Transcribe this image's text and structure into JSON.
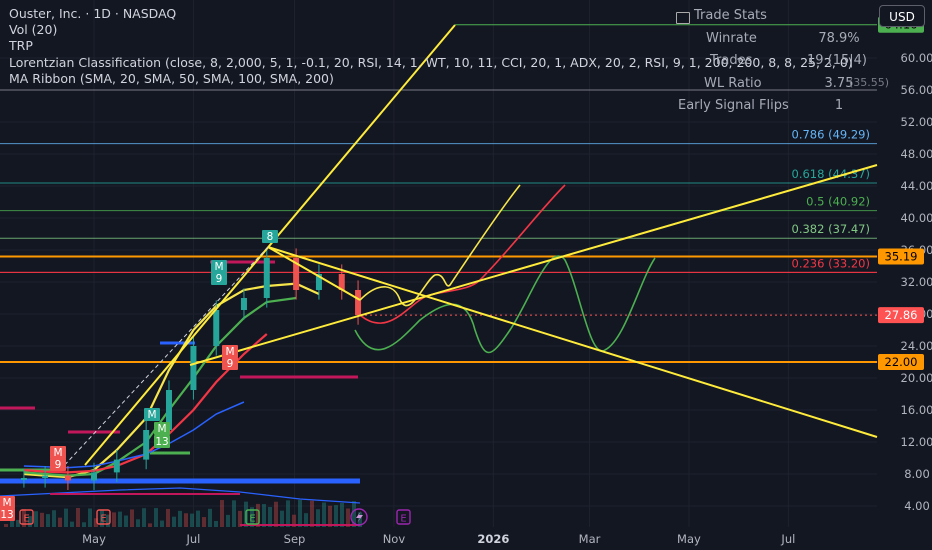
{
  "header": {
    "symbol_line": "Ouster, Inc. · 1D · NASDAQ",
    "indicators": [
      "Vol (20)",
      "TRP",
      "Lorentzian Classification (close, 8, 2,000, 5, 1, -0.1, 20, RSI, 14, 1, WT, 10, 11, CCI, 20, 1, ADX, 20, 2, RSI, 9, 1, 200, 200, 8, 8, 25, 2, 0)",
      "MA Ribbon (SMA, 20, SMA, 50, SMA, 100, SMA, 200)"
    ]
  },
  "currency_button": "USD",
  "trade_stats": {
    "title": "Trade Stats",
    "rows": [
      {
        "label": "Winrate",
        "value": "78.9%"
      },
      {
        "label": "Trades",
        "value": "19 (15|4)"
      },
      {
        "label": "WL Ratio",
        "value": "3.75"
      },
      {
        "label": "Early Signal Flips",
        "value": "1"
      }
    ],
    "overlap_text": "(35.55)"
  },
  "chart_data": {
    "type": "candlestick",
    "y_axis": {
      "range": [
        2.9,
        64.5
      ],
      "ticks": [
        "4.00",
        "8.00",
        "12.00",
        "16.00",
        "20.00",
        "24.00",
        "28.00",
        "32.00",
        "36.00",
        "40.00",
        "44.00",
        "48.00",
        "52.00",
        "56.00",
        "60.00"
      ],
      "tick_values": [
        4,
        8,
        12,
        16,
        20,
        24,
        28,
        32,
        36,
        40,
        44,
        48,
        52,
        56,
        60
      ]
    },
    "x_axis": {
      "ticks": [
        {
          "label": "May",
          "date": "2025-05-01"
        },
        {
          "label": "Jul",
          "date": "2025-07-01"
        },
        {
          "label": "Sep",
          "date": "2025-09-01"
        },
        {
          "label": "Nov",
          "date": "2025-11-01"
        },
        {
          "label": "2026",
          "date": "2026-01-01"
        },
        {
          "label": "Mar",
          "date": "2026-03-01"
        },
        {
          "label": "May",
          "date": "2026-05-01"
        },
        {
          "label": "Jul",
          "date": "2026-07-01"
        }
      ]
    },
    "price_labels": [
      {
        "text": "64.16",
        "value": 64.16,
        "bg": "#4caf50",
        "fg": "#000000"
      },
      {
        "text": "35.19",
        "value": 35.19,
        "bg": "#ff9800",
        "fg": "#000000"
      },
      {
        "text": "27.86",
        "value": 27.86,
        "bg": "#ff5252",
        "fg": "#ffffff"
      },
      {
        "text": "22.00",
        "value": 22.0,
        "bg": "#ff9800",
        "fg": "#000000"
      }
    ],
    "fib_levels": [
      {
        "label": "0.786 (49.29)",
        "value": 49.29,
        "color": "#64b5f6"
      },
      {
        "label": "0.618 (44.37)",
        "value": 44.37,
        "color": "#26a69a"
      },
      {
        "label": "0.5 (40.92)",
        "value": 40.92,
        "color": "#4caf50"
      },
      {
        "label": "0.382 (37.47)",
        "value": 37.47,
        "color": "#81c784"
      },
      {
        "label": "0.236 (33.20)",
        "value": 33.2,
        "color": "#f23645"
      }
    ],
    "horizontal_levels": [
      {
        "value": 64.16,
        "color": "#4caf50"
      },
      {
        "value": 56.0,
        "color": "#787b86"
      },
      {
        "value": 35.19,
        "color": "#ff9800"
      },
      {
        "value": 22.0,
        "color": "#ff9800"
      }
    ],
    "series": [
      {
        "type": "candles",
        "dates": [
          "2025-03-19",
          "2025-04-01",
          "2025-04-15",
          "2025-05-01",
          "2025-05-15",
          "2025-06-02",
          "2025-06-16",
          "2025-07-01",
          "2025-07-15",
          "2025-08-01",
          "2025-08-15",
          "2025-09-02",
          "2025-09-16",
          "2025-09-30",
          "2025-10-10"
        ],
        "close": [
          7.5,
          7.8,
          7.2,
          8.2,
          9.8,
          13.5,
          18.5,
          24.0,
          28.5,
          30.0,
          35.0,
          31.0,
          33.0,
          31.0,
          27.86
        ]
      },
      {
        "name": "SMA 20",
        "color": "#f7e64b",
        "close": [
          8.0,
          7.8,
          7.6,
          8.5,
          11.0,
          15.0,
          21.0,
          26.0,
          29.0,
          31.0,
          31.5,
          31.8,
          30.5
        ]
      },
      {
        "name": "SMA 50",
        "color": "#4caf50",
        "close": [
          8.2,
          8.0,
          7.8,
          8.0,
          9.5,
          12.0,
          16.0,
          20.0,
          24.0,
          27.5,
          29.5,
          30.0
        ]
      },
      {
        "name": "SMA 100",
        "color": "#f23645",
        "close": [
          8.5,
          8.3,
          8.2,
          8.4,
          9.0,
          10.5,
          13.0,
          16.0,
          19.5,
          23.0,
          25.5
        ]
      },
      {
        "name": "SMA 200",
        "color": "#2962ff",
        "close": [
          9.0,
          8.9,
          8.8,
          9.0,
          9.6,
          10.5,
          11.8,
          13.5,
          15.5,
          17.0
        ]
      }
    ]
  }
}
